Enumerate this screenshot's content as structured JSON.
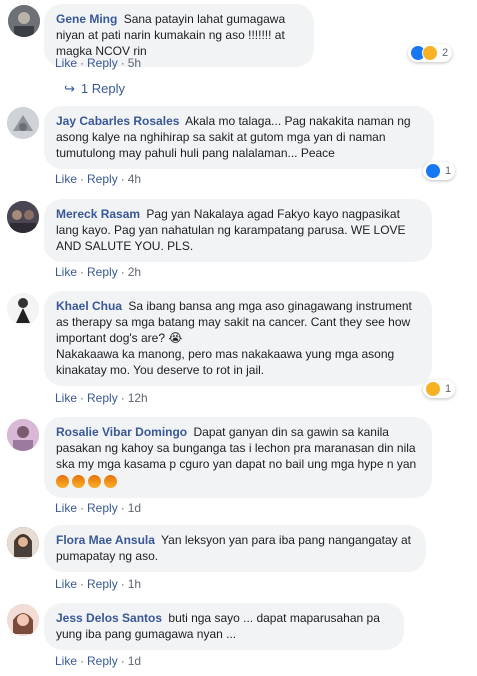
{
  "comments": [
    {
      "author": "Gene Ming",
      "text": "Sana patayin lahat gumagawa niyan at pati narin kumakain ng aso !!!!!!! at magka NCOV rin",
      "like_label": "Like",
      "reply_label": "Reply",
      "time": "5h",
      "reaction_count": "2",
      "replies_label": "1 Reply"
    },
    {
      "author": "Jay Cabarles Rosales",
      "text": "Akala mo talaga... Pag nakakita naman ng asong kalye na nghihirap sa sakit at gutom mga yan di naman tumutulong may pahuli huli pang nalalaman... Peace",
      "like_label": "Like",
      "reply_label": "Reply",
      "time": "4h",
      "reaction_count": "1"
    },
    {
      "author": "Mereck Rasam",
      "text": "Pag yan Nakalaya agad Fakyo kayo nagpasikat lang kayo. Pag yan nahatulan ng karampatang parusa. WE LOVE AND SALUTE YOU. PLS.",
      "like_label": "Like",
      "reply_label": "Reply",
      "time": "2h"
    },
    {
      "author": "Khael Chua",
      "text": "Sa ibang bansa ang mga aso ginagawang instrument as therapy sa mga batang may sakit na cancer. Cant they see how important dog's are? 😭\nNakakaawa ka manong, pero mas nakakaawa yung mga asong kinakatay mo. You deserve to rot in jail.",
      "like_label": "Like",
      "reply_label": "Reply",
      "time": "12h",
      "reaction_count": "1"
    },
    {
      "author": "Rosalie Vibar Domingo",
      "text": "Dapat ganyan din sa gawin sa kanila pasakan ng kahoy sa bunganga tas i lechon pra maranasan din nila ska my mga kasama p cguro yan dapat no bail ung mga hype n yan",
      "emoji_line": "😡😡😡😡",
      "like_label": "Like",
      "reply_label": "Reply",
      "time": "1d"
    },
    {
      "author": "Flora Mae Ansula",
      "text": "Yan leksyon yan para iba pang nangangatay at pumapatay ng aso.",
      "like_label": "Like",
      "reply_label": "Reply",
      "time": "1h"
    },
    {
      "author": "Jess Delos Santos",
      "text": "buti nga sayo ... dapat maparusahan pa yung iba pang gumagawa nyan ...",
      "like_label": "Like",
      "reply_label": "Reply",
      "time": "1d"
    }
  ]
}
